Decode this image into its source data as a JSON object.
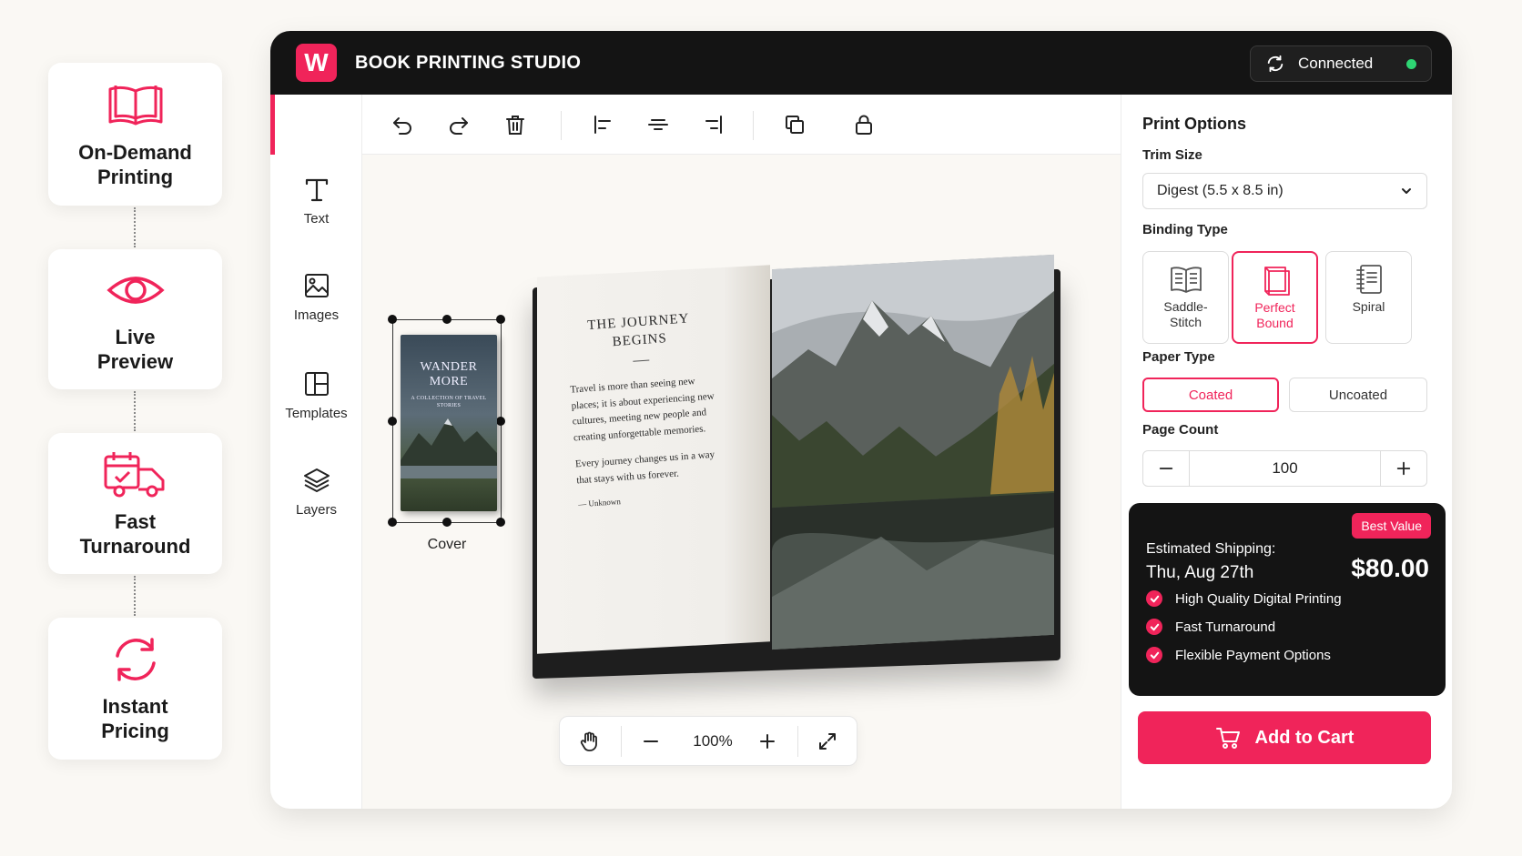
{
  "features": [
    {
      "title": "On-Demand Printing",
      "icon": "open-book-icon"
    },
    {
      "title": "Live Preview",
      "icon": "eye-icon"
    },
    {
      "title": "Fast Turnaround",
      "icon": "delivery-truck-icon"
    },
    {
      "title": "Instant Pricing",
      "icon": "refresh-icon"
    }
  ],
  "header": {
    "logo": "W",
    "title": "BOOK PRINTING STUDIO",
    "status": "Connected"
  },
  "tools": [
    {
      "label": "Text",
      "icon": "text-icon"
    },
    {
      "label": "Images",
      "icon": "image-icon"
    },
    {
      "label": "Templates",
      "icon": "templates-icon"
    },
    {
      "label": "Layers",
      "icon": "layers-icon"
    }
  ],
  "canvas": {
    "cover_title": "WANDER MORE",
    "cover_subtitle": "A COLLECTION OF TRAVEL STORIES",
    "cover_label": "Cover",
    "page_heading": "THE JOURNEY BEGINS",
    "page_para1": "Travel is more than seeing new places; it is about experiencing new cultures, meeting new people and creating unforgettable memories.",
    "page_para2": "Every journey changes us in a way that stays with us forever.",
    "page_author": "— Unknown",
    "zoom": "100%"
  },
  "panel": {
    "title": "Print Options",
    "trim_label": "Trim Size",
    "trim_value": "Digest (5.5 x 8.5 in)",
    "binding_label": "Binding Type",
    "bindings": [
      "Saddle-Stitch",
      "Perfect Bound",
      "Spiral"
    ],
    "binding_selected": "Perfect Bound",
    "paper_label": "Paper Type",
    "papers": [
      "Coated",
      "Uncoated"
    ],
    "paper_selected": "Coated",
    "page_count_label": "Page Count",
    "page_count": "100"
  },
  "summary": {
    "badge": "Best Value",
    "shipping_label": "Estimated Shipping:",
    "shipping_date": "Thu, Aug 27th",
    "price": "$80.00",
    "features": [
      "High Quality Digital Printing",
      "Fast Turnaround",
      "Flexible Payment Options"
    ]
  },
  "cart_label": "Add to Cart",
  "colors": {
    "accent": "#f0245a",
    "dark": "#141414",
    "status": "#2ed573"
  }
}
